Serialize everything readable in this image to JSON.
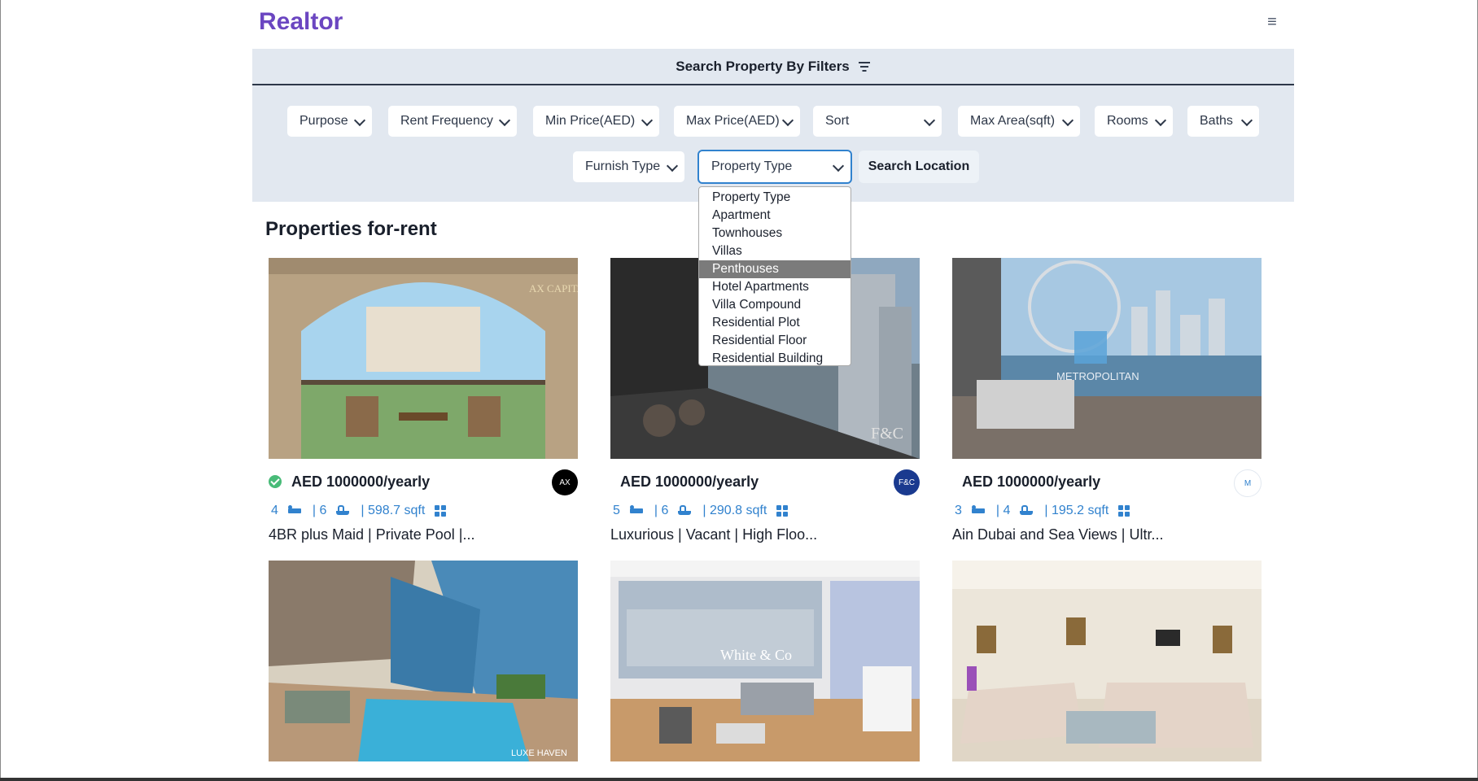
{
  "brand": "Realtor",
  "menu_icon": "hamburger-icon",
  "filters": {
    "header": "Search Property By Filters",
    "selects": [
      {
        "label": "Purpose"
      },
      {
        "label": "Rent Frequency"
      },
      {
        "label": "Min Price(AED)"
      },
      {
        "label": "Max Price(AED)"
      },
      {
        "label": "Sort"
      },
      {
        "label": "Max Area(sqft)"
      },
      {
        "label": "Rooms"
      },
      {
        "label": "Baths"
      },
      {
        "label": "Furnish Type"
      },
      {
        "label": "Property Type"
      }
    ],
    "search_location": "Search Location"
  },
  "dropdown": {
    "options": [
      "Property Type",
      "Apartment",
      "Townhouses",
      "Villas",
      "Penthouses",
      "Hotel Apartments",
      "Villa Compound",
      "Residential Plot",
      "Residential Floor",
      "Residential Building"
    ],
    "highlighted": "Penthouses"
  },
  "section_title": "Properties for-rent",
  "cards": [
    {
      "price": "AED 1000000/yearly",
      "verified": true,
      "rooms": "4",
      "baths": "| 6",
      "area": "| 598.7 sqft",
      "title": "4BR plus Maid | Private Pool |...",
      "agency_text": "AX",
      "agency_color": "#000000"
    },
    {
      "price": "AED 1000000/yearly",
      "verified": false,
      "rooms": "5",
      "baths": "| 6",
      "area": "| 290.8 sqft",
      "title": "Luxurious | Vacant | High Floo...",
      "agency_text": "F&C",
      "agency_color": "#1a3a8f"
    },
    {
      "price": "AED 1000000/yearly",
      "verified": false,
      "rooms": "3",
      "baths": "| 4",
      "area": "| 195.2 sqft",
      "title": "Ain Dubai and Sea Views | Ultr...",
      "agency_text": "M",
      "agency_color": "#ffffff"
    }
  ],
  "photo_overlays": {
    "c1": "AX CAPITAL",
    "c2": "F&C",
    "c3": "METROPOLITAN",
    "c4": "LUXE HAVEN",
    "c5": "White & Co"
  },
  "colors": {
    "brand": "#6b46c1",
    "accent": "#3182ce",
    "panel": "#e2e8f0",
    "verified": "#48bb78",
    "highlight": "#7b7b7b"
  }
}
